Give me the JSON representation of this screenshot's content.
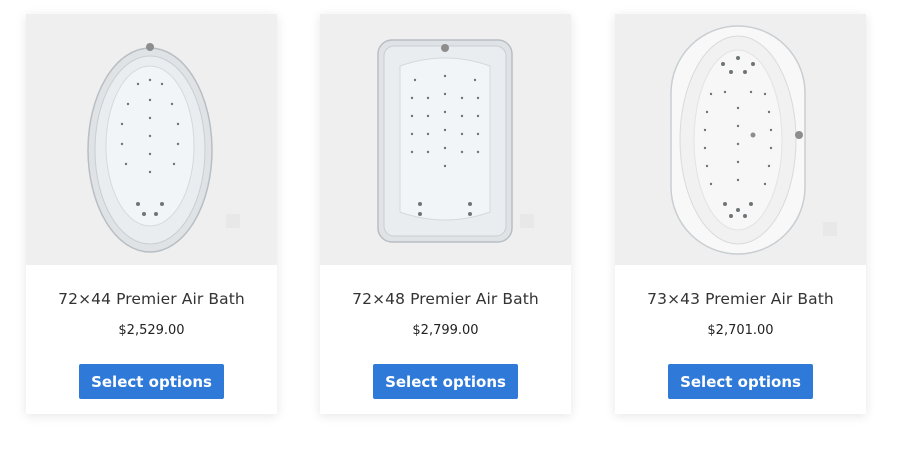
{
  "products": [
    {
      "title": "72×44 Premier Air Bath",
      "price": "$2,529.00",
      "button_label": "Select options",
      "image_icon": "oval-tub-icon"
    },
    {
      "title": "72×48 Premier Air Bath",
      "price": "$2,799.00",
      "button_label": "Select options",
      "image_icon": "rectangular-tub-icon"
    },
    {
      "title": "73×43 Premier Air Bath",
      "price": "$2,701.00",
      "button_label": "Select options",
      "image_icon": "oval-drop-in-tub-icon"
    }
  ],
  "colors": {
    "button": "#2f7ad8",
    "image_background": "#efefef",
    "title_text": "#333333",
    "price_text": "#222222"
  }
}
